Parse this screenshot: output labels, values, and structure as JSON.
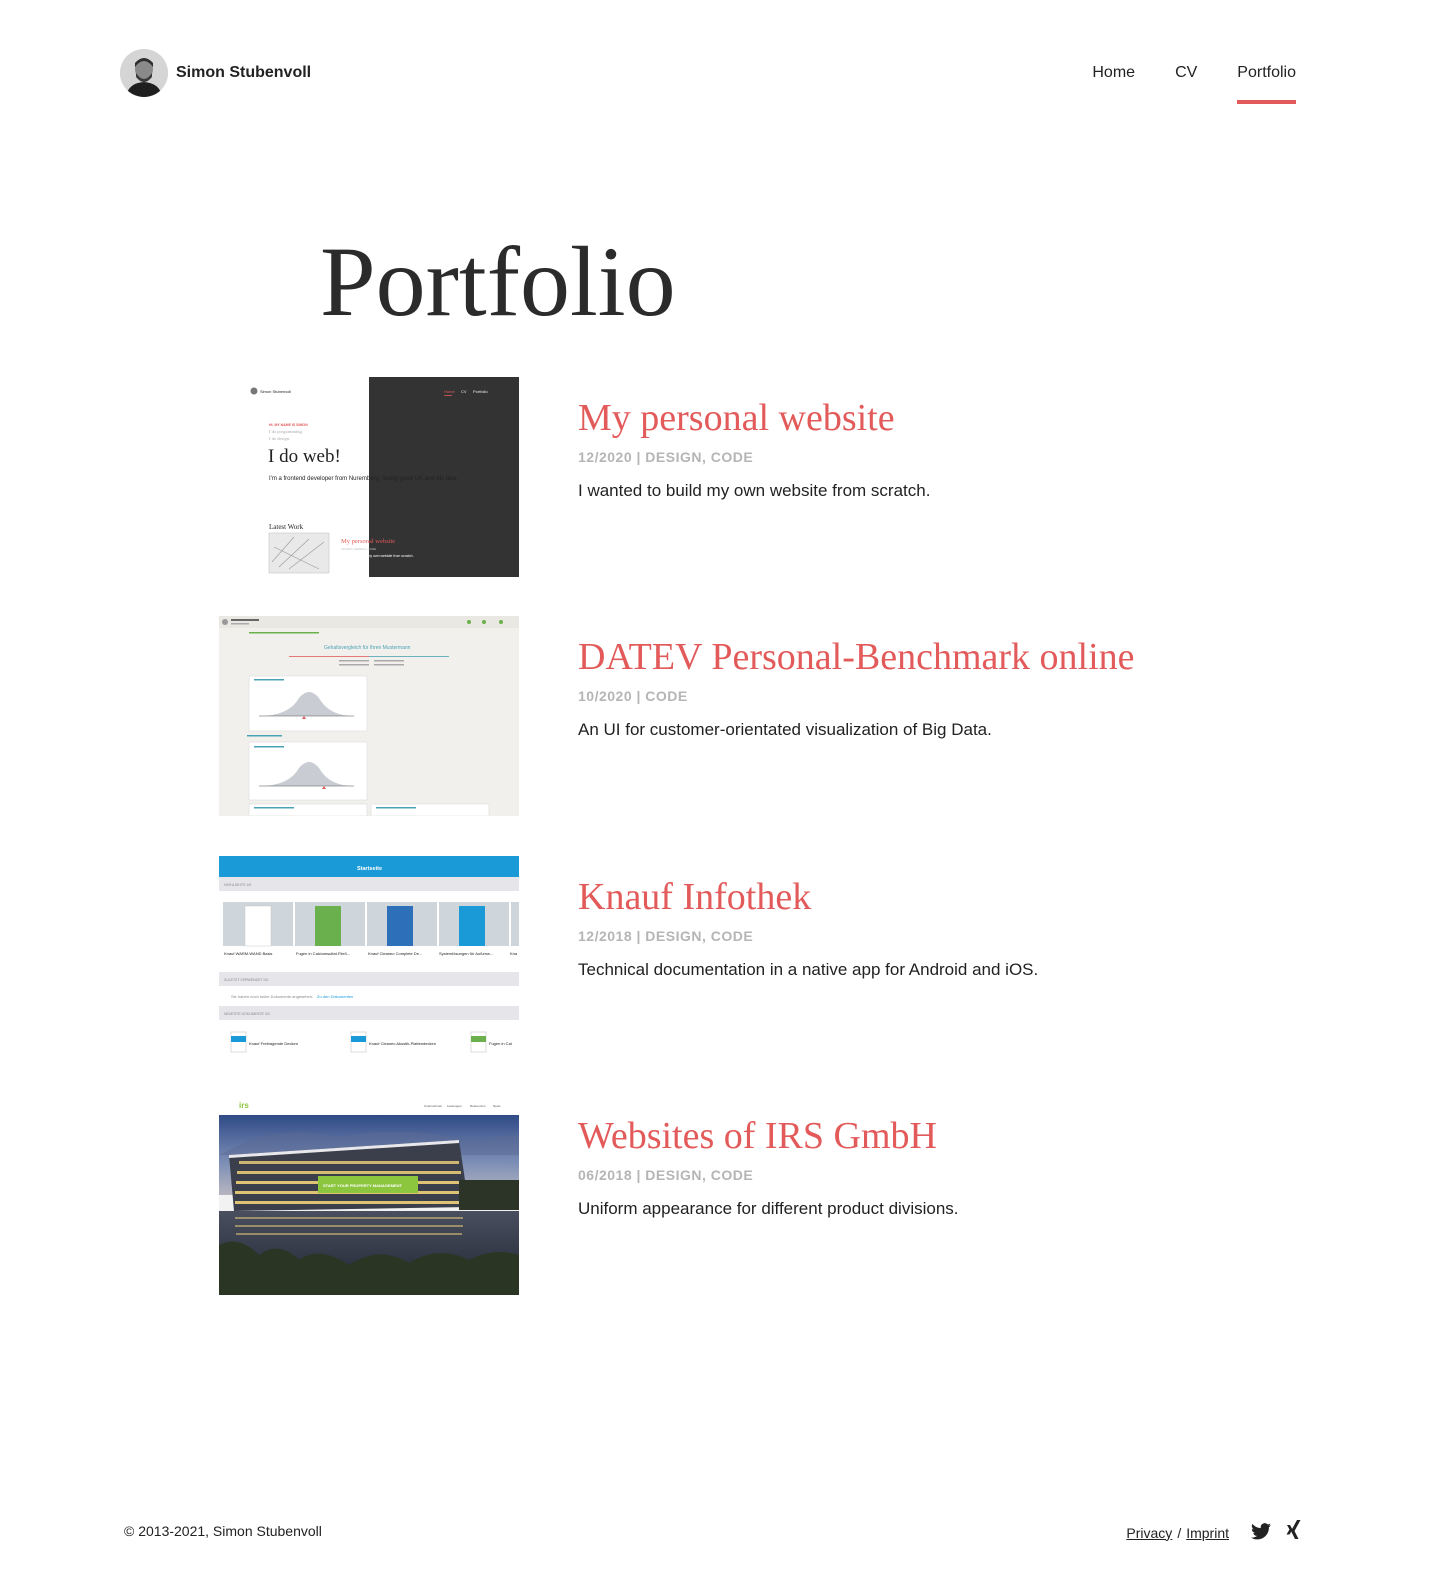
{
  "header": {
    "brand_name": "Simon Stubenvoll",
    "nav": [
      {
        "label": "Home"
      },
      {
        "label": "CV"
      },
      {
        "label": "Portfolio",
        "active": true
      }
    ]
  },
  "page_title": "Portfolio",
  "accent_color": "#e35a5a",
  "entries": [
    {
      "title": "My personal website",
      "meta": "12/2020 | DESIGN, CODE",
      "description": "I wanted to build my own website from scratch.",
      "thumb": {
        "brand": "Simon Stubenvoll",
        "nav": [
          "Home",
          "CV",
          "Portfolio"
        ],
        "kicker": "HI, MY NAME IS SIMON",
        "lines": [
          "I do programming.",
          "I do design."
        ],
        "headline": "I do web!",
        "intro": "I'm a frontend developer from Nuremberg, loving good UX and his bike.",
        "latest": "Latest Work",
        "card_title": "My personal website",
        "card_meta": "12/2020 | DESIGN, CODE",
        "card_desc": "I wanted to build my own website from scratch."
      }
    },
    {
      "title": "DATEV Personal-Benchmark online",
      "meta": "10/2020 | CODE",
      "description": "An UI for customer-orientated visualization of Big Data.",
      "thumb": {
        "heading": "Gehaltsvergleich für Ihren Mustermann"
      }
    },
    {
      "title": "Knauf Infothek",
      "meta": "12/2018 | DESIGN, CODE",
      "description": "Technical documentation in a native app for Android and iOS.",
      "thumb": {
        "bar_title": "Startseite",
        "section1": "HIGHLIGHTS 1/5",
        "items": [
          "Knauf WARM-WAND Basis",
          "Fugen in Calciumsulfat-Fließ...",
          "Knauf Cleaneo Complete De...",
          "Systemlösungen für Außenw...",
          "Kna"
        ],
        "section2": "ZULETZT VERWENDET 0/0",
        "empty_text": "Sie haben noch keine Dokumente angesehen.",
        "empty_link": "Zu den Dokumenten",
        "section3": "NEUESTE DOKUMENTE 3/3",
        "docs": [
          "Knauf Freitragende Decken",
          "Knauf Cleaneo Akustik-Plattendecken",
          "Fugen in Cal"
        ]
      }
    },
    {
      "title": "Websites of IRS GmbH",
      "meta": "06/2018 | DESIGN, CODE",
      "description": "Uniform appearance for different product divisions.",
      "thumb": {
        "logo": "irs",
        "nav": [
          "Unternehmen",
          "Leistungen",
          "Referenzen",
          "News"
        ],
        "cta": "START YOUR PROPERTY MANAGEMENT"
      }
    }
  ],
  "footer": {
    "copyright": "© 2013-2021, Simon Stubenvoll",
    "privacy": "Privacy",
    "separator": "/",
    "imprint": "Imprint"
  }
}
